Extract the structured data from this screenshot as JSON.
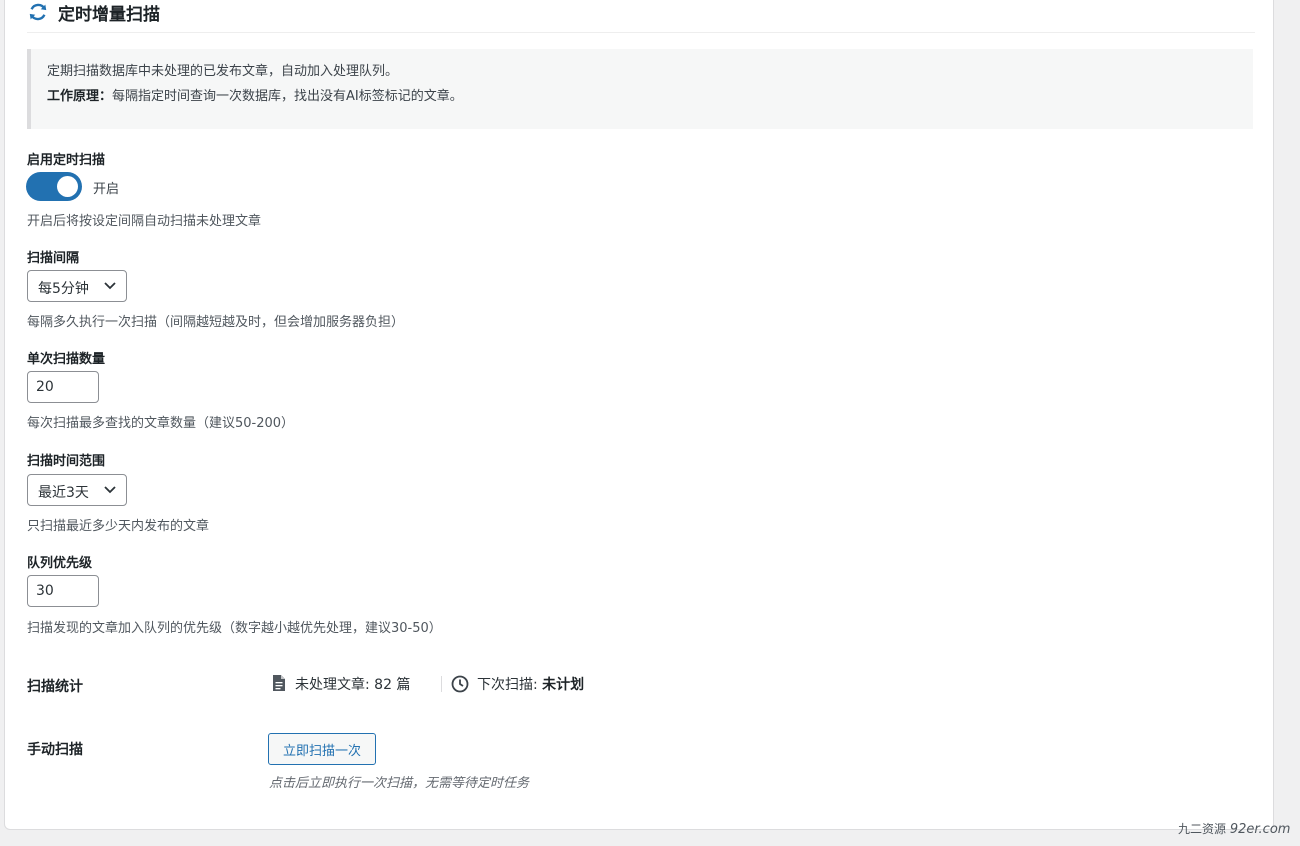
{
  "section": {
    "title": "定时增量扫描",
    "icon": "refresh-icon"
  },
  "notice": {
    "line1": "定期扫描数据库中未处理的已发布文章，自动加入处理队列。",
    "principle_label": "工作原理：",
    "principle_text": "每隔指定时间查询一次数据库，找出没有AI标签标记的文章。"
  },
  "enable_scan": {
    "label": "启用定时扫描",
    "state_text": "开启",
    "enabled": true,
    "description": "开启后将按设定间隔自动扫描未处理文章"
  },
  "scan_interval": {
    "label": "扫描间隔",
    "selected": "每5分钟",
    "description": "每隔多久执行一次扫描（间隔越短越及时，但会增加服务器负担）"
  },
  "batch_size": {
    "label": "单次扫描数量",
    "value": "20",
    "description": "每次扫描最多查找的文章数量（建议50-200）"
  },
  "time_range": {
    "label": "扫描时间范围",
    "selected": "最近3天",
    "description": "只扫描最近多少天内发布的文章"
  },
  "queue_priority": {
    "label": "队列优先级",
    "value": "30",
    "description": "扫描发现的文章加入队列的优先级（数字越小越优先处理，建议30-50）"
  },
  "stats": {
    "label": "扫描统计",
    "unprocessed_text": "未处理文章: 82 篇",
    "next_scan_label": "下次扫描: ",
    "next_scan_value": "未计划",
    "doc_icon": "document-icon",
    "clock_icon": "clock-icon"
  },
  "manual_scan": {
    "label": "手动扫描",
    "button_label": "立即扫描一次",
    "note": "点击后立即执行一次扫描，无需等待定时任务"
  },
  "watermark": {
    "cn": "九二资源",
    "en": "92er.com"
  },
  "colors": {
    "accent": "#2271b1",
    "notice_bg": "#f6f7f7"
  }
}
